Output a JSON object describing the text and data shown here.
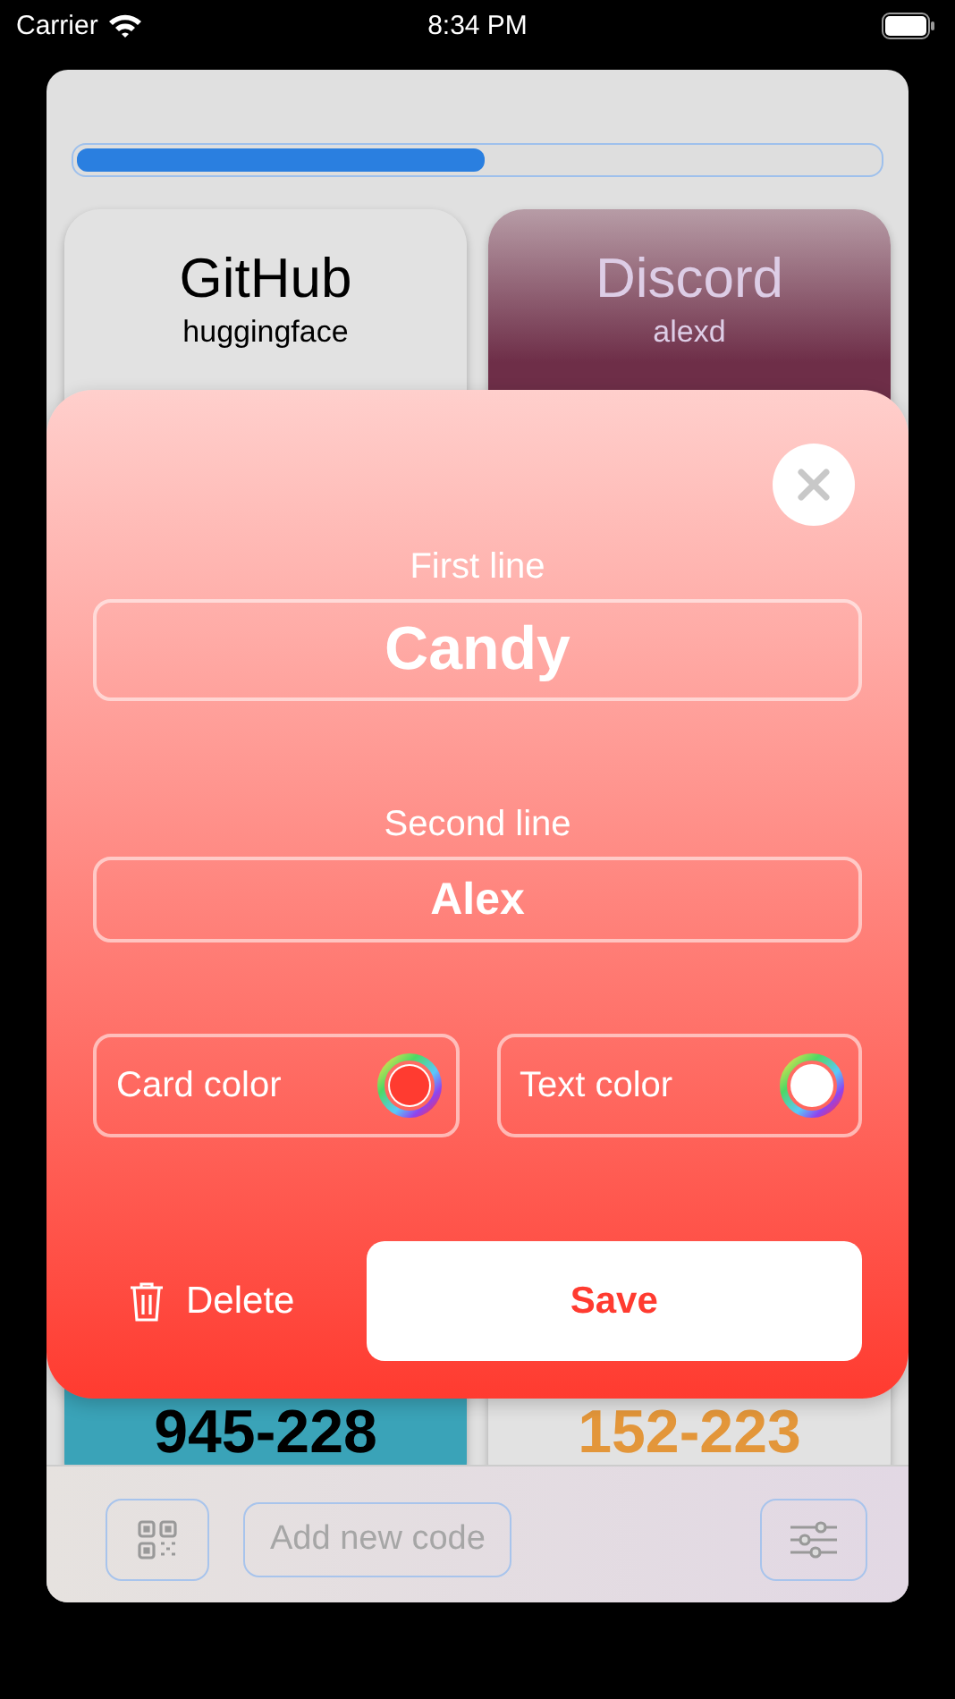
{
  "status_bar": {
    "carrier": "Carrier",
    "time": "8:34 PM"
  },
  "progress": {
    "level": 0.51
  },
  "cards": [
    {
      "title": "GitHub",
      "subtitle": "huggingface",
      "color": "#e2e2e2"
    },
    {
      "title": "Discord",
      "subtitle": "alexd",
      "color": "#6e2e48"
    },
    {
      "code": "945-228",
      "color": "#3aa3b8"
    },
    {
      "code": "152-223",
      "color": "#e2e2e2"
    }
  ],
  "editor": {
    "fields": [
      {
        "label": "First line",
        "value": "Candy"
      },
      {
        "label": "Second line",
        "value": "Alex"
      }
    ],
    "color_pickers": [
      {
        "label": "Card color",
        "color": "#ff3b30"
      },
      {
        "label": "Text color",
        "color": "#ffffff"
      }
    ],
    "delete_label": "Delete",
    "save_label": "Save"
  },
  "toolbar": {
    "add_label": "Add new code"
  }
}
